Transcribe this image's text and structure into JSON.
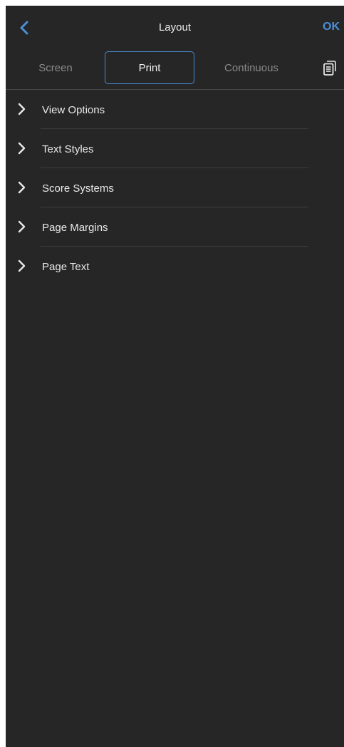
{
  "header": {
    "title": "Layout",
    "ok_label": "OK",
    "back_icon": "chevron-left-icon"
  },
  "tabs": [
    {
      "label": "Screen",
      "selected": false
    },
    {
      "label": "Print",
      "selected": true
    },
    {
      "label": "Continuous",
      "selected": false
    }
  ],
  "toolbar": {
    "doc_icon": "document-pages-icon"
  },
  "sections": [
    {
      "label": "View Options"
    },
    {
      "label": "Text Styles"
    },
    {
      "label": "Score Systems"
    },
    {
      "label": "Page Margins"
    },
    {
      "label": "Page Text"
    }
  ],
  "colors": {
    "panel_background": "#262626",
    "accent": "#4a90d9",
    "text": "#e8e8e8",
    "muted_text": "#8a8a8a"
  }
}
